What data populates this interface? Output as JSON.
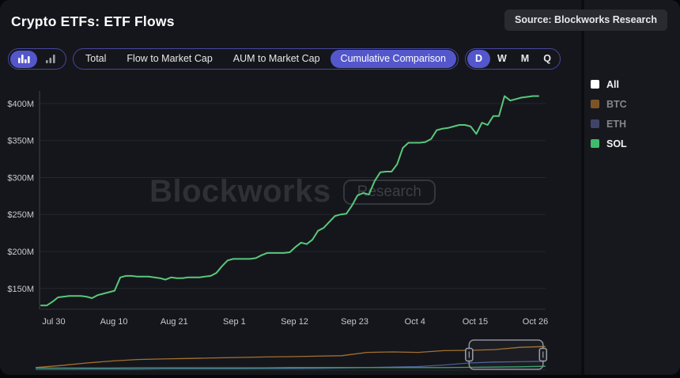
{
  "header": {
    "title": "Crypto ETFs: ETF Flows",
    "source_badge": "Source: Blockworks Research"
  },
  "toolbar": {
    "chart_type_toggle": {
      "icons": [
        {
          "name": "bar-chart-icon",
          "selected": true
        },
        {
          "name": "column-bars-icon",
          "selected": false
        }
      ]
    },
    "metric_tabs": [
      {
        "label": "Total",
        "selected": false
      },
      {
        "label": "Flow to Market Cap",
        "selected": false
      },
      {
        "label": "AUM to Market Cap",
        "selected": false
      },
      {
        "label": "Cumulative Comparison",
        "selected": true
      }
    ],
    "period_tabs": [
      {
        "label": "D",
        "selected": true
      },
      {
        "label": "W",
        "selected": false
      },
      {
        "label": "M",
        "selected": false
      },
      {
        "label": "Q",
        "selected": false
      }
    ]
  },
  "legend": {
    "items": [
      {
        "label": "All",
        "color": "#ffffff",
        "active": true
      },
      {
        "label": "BTC",
        "color": "#7d5427",
        "active": false
      },
      {
        "label": "ETH",
        "color": "#3f4468",
        "active": false
      },
      {
        "label": "SOL",
        "color": "#3ebb6c",
        "active": true
      }
    ]
  },
  "watermark": {
    "brand": "Blockworks",
    "tag": "Research"
  },
  "colors": {
    "accent_purple": "#5457cb",
    "group_border": "#45489e",
    "card_bg": "#15161b",
    "grid": "#25272d",
    "axis": "#3e424a",
    "tick_text": "#c7c9ce",
    "sol_line": "#58c87c",
    "nav_btc": "#a4702f",
    "nav_eth": "#4b5c95",
    "nav_sol": "#37a06a",
    "window_stroke": "#8b9199"
  },
  "chart_data": [
    {
      "type": "line",
      "title": "Crypto ETFs: ETF Flows — Cumulative Comparison (Daily)",
      "unit": "USD millions",
      "ylim": [
        122,
        417
      ],
      "grid": true,
      "legend_position": "right",
      "y_ticks": [
        {
          "value": 400,
          "label": "$400M"
        },
        {
          "value": 350,
          "label": "$350M"
        },
        {
          "value": 300,
          "label": "$300M"
        },
        {
          "value": 250,
          "label": "$250M"
        },
        {
          "value": 200,
          "label": "$200M"
        },
        {
          "value": 150,
          "label": "$150M"
        }
      ],
      "x_tick_labels": [
        "Jul 30",
        "Aug 10",
        "Aug 21",
        "Sep 1",
        "Sep 12",
        "Sep 23",
        "Oct 4",
        "Oct 15",
        "Oct 26"
      ],
      "series": [
        {
          "name": "SOL",
          "color": "#58c87c",
          "values": [
            127,
            127,
            132,
            138,
            139,
            140,
            140,
            140,
            139,
            137,
            141,
            143,
            145,
            147,
            165,
            167,
            167,
            166,
            166,
            166,
            165,
            164,
            162,
            165,
            164,
            164,
            165,
            165,
            165,
            166,
            167,
            171,
            180,
            188,
            190,
            190,
            190,
            190,
            191,
            195,
            198,
            198,
            198,
            198,
            199,
            206,
            212,
            210,
            216,
            228,
            232,
            240,
            248,
            250,
            251,
            262,
            276,
            279,
            277,
            295,
            307,
            308,
            308,
            318,
            340,
            347,
            347,
            347,
            348,
            352,
            364,
            366,
            367,
            369,
            371,
            371,
            369,
            359,
            374,
            371,
            383,
            383,
            410,
            404,
            406,
            408,
            409,
            410,
            410
          ]
        }
      ]
    },
    {
      "type": "line",
      "role": "range-navigator",
      "window": {
        "start_pct": 85,
        "end_pct": 99.5
      },
      "series": [
        {
          "name": "BTC",
          "color": "#a4702f",
          "values_pct": [
            10,
            18,
            28,
            36,
            42,
            44,
            46,
            48,
            50,
            52,
            53,
            55,
            57,
            70,
            72,
            70,
            77,
            78,
            81,
            90,
            93
          ]
        },
        {
          "name": "ETH",
          "color": "#4b5c95",
          "values_pct": [
            3,
            3,
            4,
            4,
            4,
            5,
            5,
            5,
            5,
            6,
            6,
            7,
            8,
            10,
            12,
            14,
            20,
            28,
            32,
            33,
            35
          ]
        },
        {
          "name": "SOL",
          "color": "#37a06a",
          "values_pct": [
            8,
            8,
            8,
            8,
            9,
            9,
            9,
            9,
            9,
            9,
            10,
            10,
            10,
            10,
            10,
            10,
            10,
            11,
            12,
            13,
            15
          ]
        }
      ]
    }
  ]
}
